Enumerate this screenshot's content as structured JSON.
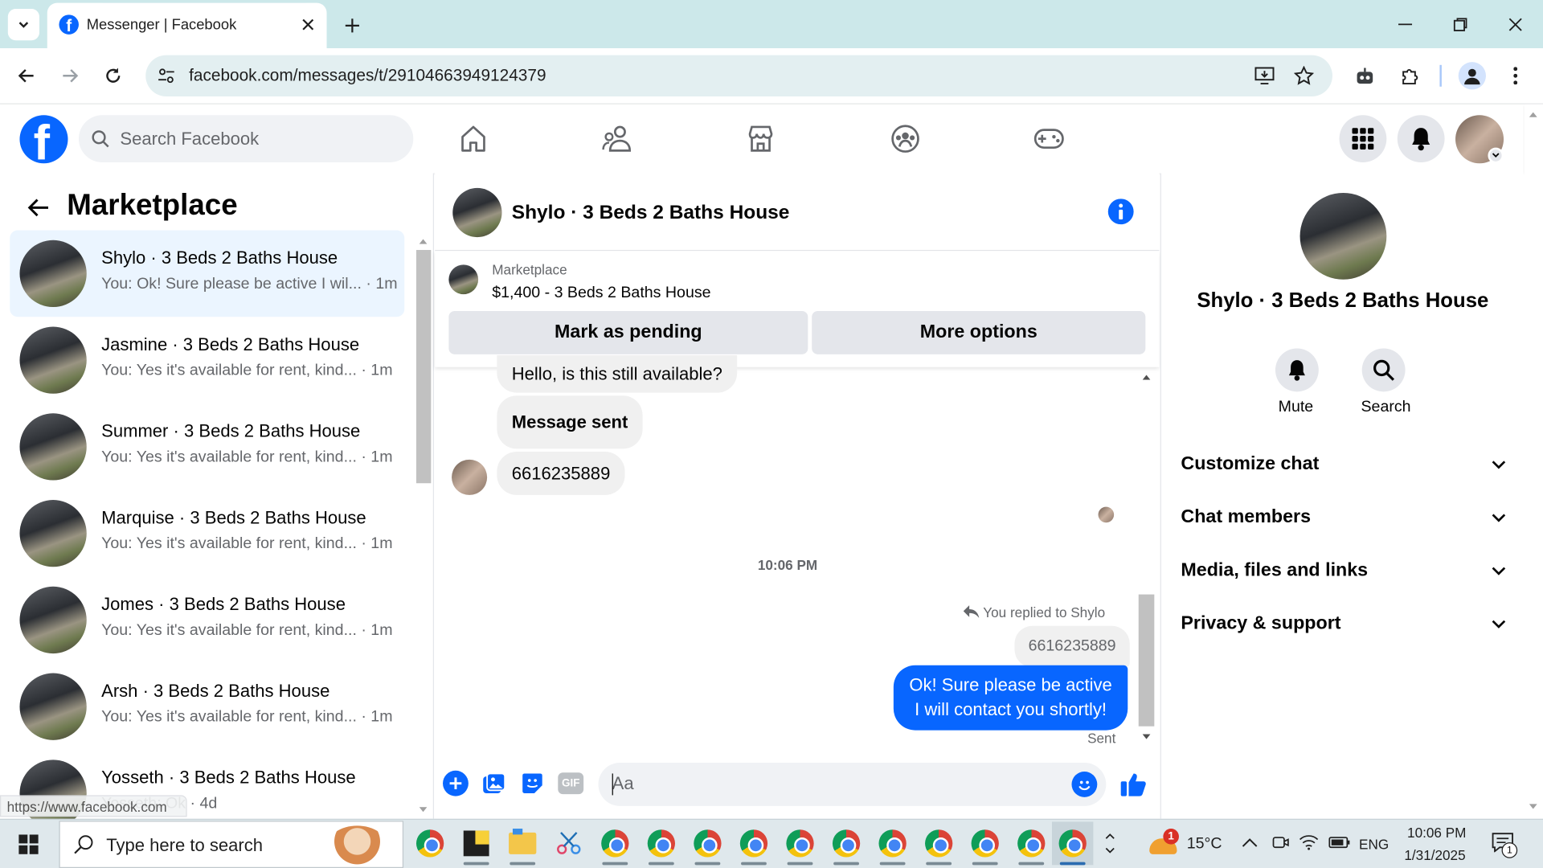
{
  "browser": {
    "tab_title": "Messenger | Facebook",
    "url": "facebook.com/messages/t/29104663949124379",
    "status_url": "https://www.facebook.com"
  },
  "fb": {
    "search_placeholder": "Search Facebook",
    "brand_color": "#0866ff"
  },
  "sidebar": {
    "title": "Marketplace",
    "conversations": [
      {
        "name": "Shylo · 3 Beds 2 Baths House",
        "preview": "You: Ok! Sure please be active I wil... · 1m",
        "selected": true
      },
      {
        "name": "Jasmine · 3 Beds 2 Baths House",
        "preview": "You: Yes it's available for rent, kind... · 1m"
      },
      {
        "name": "Summer · 3 Beds 2 Baths House",
        "preview": "You: Yes it's available for rent, kind... · 1m"
      },
      {
        "name": "Marquise · 3 Beds 2 Baths House",
        "preview": "You: Yes it's available for rent, kind... · 1m"
      },
      {
        "name": "Jomes · 3 Beds 2 Baths House",
        "preview": "You: Yes it's available for rent, kind... · 1m"
      },
      {
        "name": "Arsh · 3 Beds 2 Baths House",
        "preview": "You: Yes it's available for rent, kind... · 1m"
      },
      {
        "name": "Yosseth · 3 Beds 2 Baths House",
        "preview": "Yosseth: Ok · 4d"
      }
    ]
  },
  "chat": {
    "title": "Shylo · 3 Beds 2 Baths House",
    "listing_label": "Marketplace",
    "listing_text": "$1,400 - 3 Beds 2 Baths House",
    "mark_pending_label": "Mark as pending",
    "more_options_label": "More options",
    "messages": [
      "Hello, is this still available?",
      "Message sent",
      "6616235889"
    ],
    "timestamp": "10:06 PM",
    "reply_note": "You replied to Shylo",
    "quoted": "6616235889",
    "sent_line1": "Ok! Sure please be active",
    "sent_line2": "I will contact you shortly!",
    "sent_status": "Sent",
    "composer_placeholder": "Aa"
  },
  "details": {
    "name": "Shylo · 3 Beds 2 Baths House",
    "mute_label": "Mute",
    "search_label": "Search",
    "sections": [
      "Customize chat",
      "Chat members",
      "Media, files and links",
      "Privacy & support"
    ]
  },
  "taskbar": {
    "search_placeholder": "Type here to search",
    "weather": "15°C",
    "weather_badge": "1",
    "lang": "ENG",
    "time": "10:06 PM",
    "date": "1/31/2025",
    "notif_count": "1"
  }
}
